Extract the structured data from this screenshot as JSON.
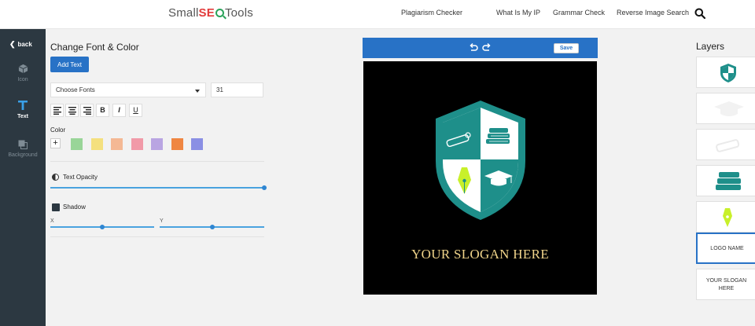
{
  "header": {
    "logo_small": "Small",
    "logo_seo": "SE",
    "logo_tools": "Tools",
    "nav": [
      "Plagiarism Checker",
      "What Is My IP",
      "Grammar Check",
      "Reverse Image Search"
    ],
    "search_icon": "search-icon"
  },
  "sidebar": {
    "back_label": "back",
    "items": [
      {
        "label": "Icon",
        "icon": "cube-icon",
        "active": false
      },
      {
        "label": "Text",
        "icon": "text-icon",
        "active": true
      },
      {
        "label": "Background",
        "icon": "background-icon",
        "active": false
      }
    ]
  },
  "panel": {
    "title": "Change Font & Color",
    "add_text_label": "Add Text",
    "font_select_value": "Choose Fonts",
    "font_size_value": "31",
    "format_buttons": [
      "align-left",
      "align-center",
      "align-right",
      "B",
      "I",
      "U"
    ],
    "color_label": "Color",
    "add_color_label": "+",
    "swatches": [
      "#99d598",
      "#f4e07e",
      "#f4b894",
      "#f19aa8",
      "#b9a5e2",
      "#ef8642",
      "#8a8fe4"
    ],
    "opacity_label": "Text Opacity",
    "opacity_value": 1.0,
    "shadow_label": "Shadow",
    "shadow_x_label": "X",
    "shadow_y_label": "Y",
    "shadow_x_value": 0.5,
    "shadow_y_value": 0.5
  },
  "canvas": {
    "save_label": "Save",
    "slogan": "YOUR SLOGAN HERE",
    "background_color": "#000000",
    "shield_color": "#1e8f8a",
    "accent_color": "#c8f02a",
    "slogan_color": "#f0d48a"
  },
  "layers": {
    "title": "Layers",
    "items": [
      {
        "type": "icon",
        "icon": "shield-icon"
      },
      {
        "type": "icon",
        "icon": "graduation-cap-icon"
      },
      {
        "type": "icon",
        "icon": "diploma-icon"
      },
      {
        "type": "icon",
        "icon": "books-icon"
      },
      {
        "type": "icon",
        "icon": "pen-nib-icon"
      },
      {
        "type": "text",
        "label": "LOGO NAME",
        "selected": true
      },
      {
        "type": "text",
        "label": "YOUR SLOGAN HERE",
        "selected": false
      }
    ]
  },
  "colors": {
    "primary": "#2872c6",
    "sidebar_bg": "#2c3841"
  }
}
